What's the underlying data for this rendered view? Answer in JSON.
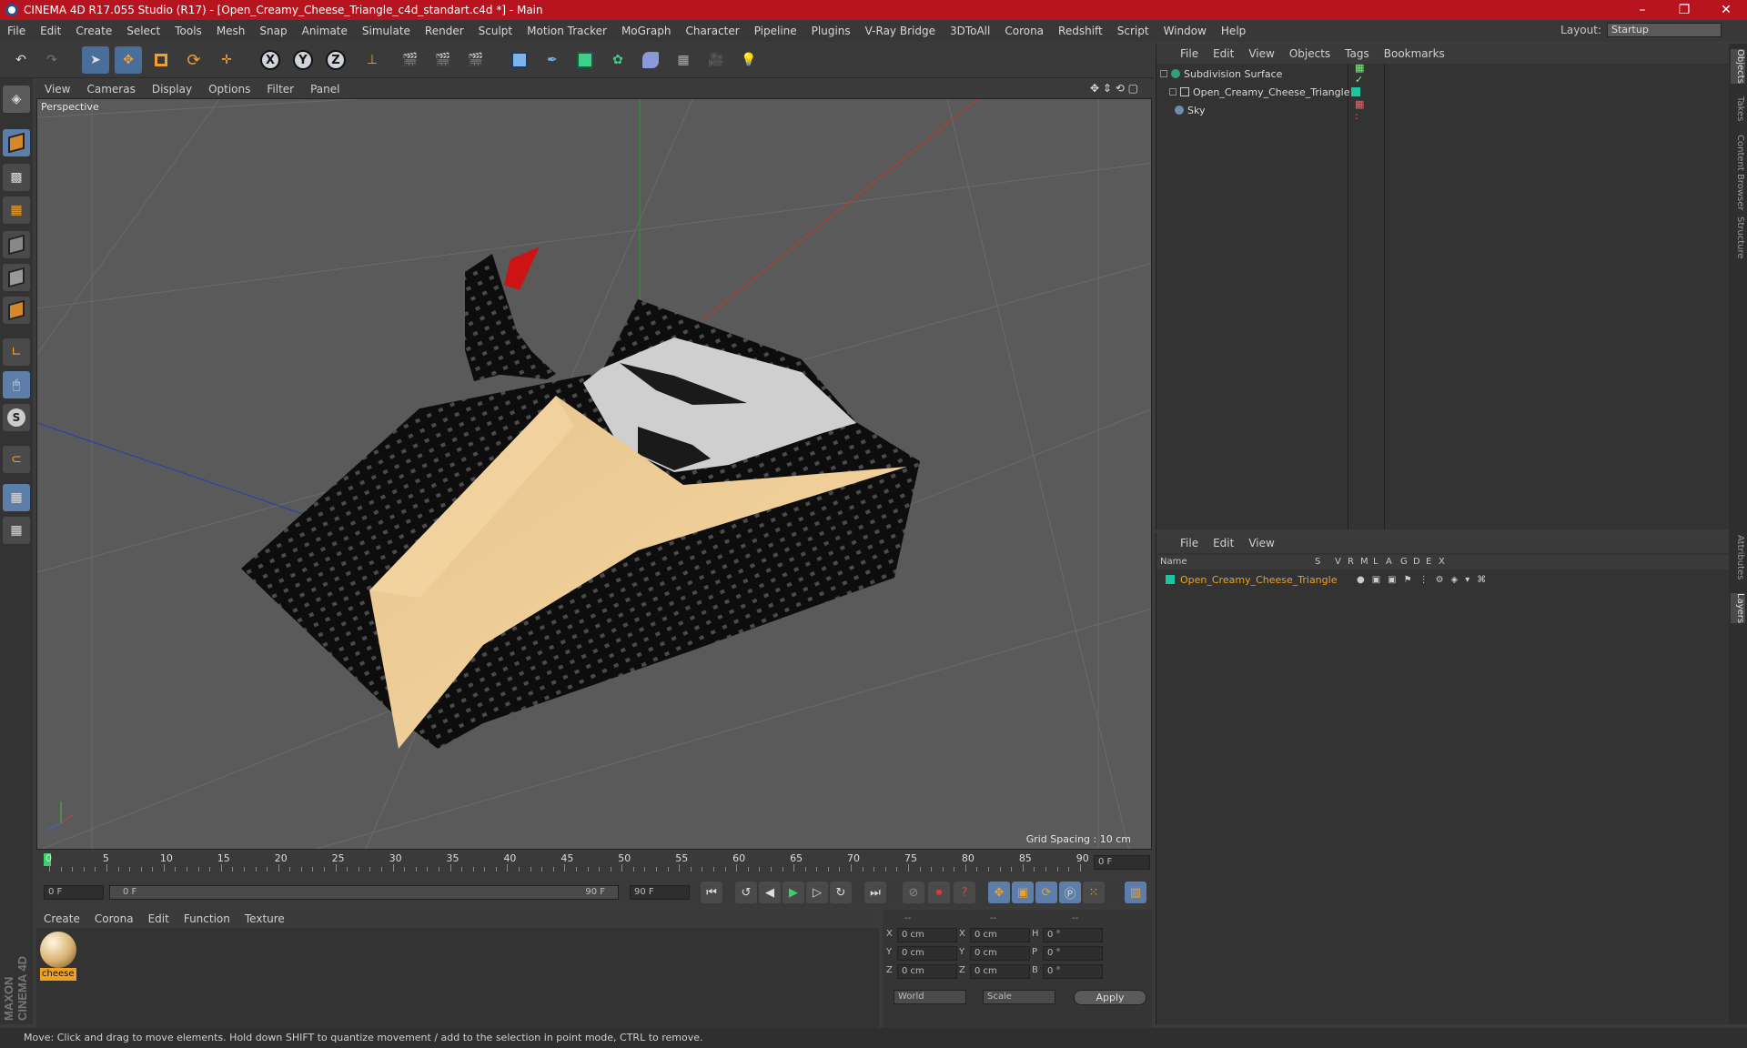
{
  "window": {
    "title": "CINEMA 4D R17.055 Studio (R17) - [Open_Creamy_Cheese_Triangle_c4d_standart.c4d *] - Main",
    "minimize": "–",
    "maximize": "❐",
    "close": "✕"
  },
  "menubar": [
    "File",
    "Edit",
    "Create",
    "Select",
    "Tools",
    "Mesh",
    "Snap",
    "Animate",
    "Simulate",
    "Render",
    "Sculpt",
    "Motion Tracker",
    "MoGraph",
    "Character",
    "Pipeline",
    "Plugins",
    "V-Ray Bridge",
    "3DToAll",
    "Corona",
    "Redshift",
    "Script",
    "Window",
    "Help"
  ],
  "layout": {
    "label": "Layout:",
    "value": "Startup"
  },
  "toolbar": {
    "axes": [
      "X",
      "Y",
      "Z"
    ]
  },
  "viewport": {
    "menu": [
      "View",
      "Cameras",
      "Display",
      "Options",
      "Filter",
      "Panel"
    ],
    "label": "Perspective",
    "grid_spacing": "Grid Spacing : 10 cm"
  },
  "timeline": {
    "ticks": [
      "0",
      "5",
      "10",
      "15",
      "20",
      "25",
      "30",
      "35",
      "40",
      "45",
      "50",
      "55",
      "60",
      "65",
      "70",
      "75",
      "80",
      "85",
      "90"
    ],
    "current_frame": "0 F",
    "start_field": "0 F",
    "range_start": "0 F",
    "range_end": "90 F",
    "end_field": "90 F"
  },
  "materials": {
    "menu": [
      "Create",
      "Corona",
      "Edit",
      "Function",
      "Texture"
    ],
    "items": [
      {
        "name": "cheese"
      }
    ]
  },
  "coordinates": {
    "header": [
      "--",
      "--",
      "--"
    ],
    "rows": [
      {
        "a": "X",
        "av": "0 cm",
        "b": "X",
        "bv": "0 cm",
        "c": "H",
        "cv": "0 °"
      },
      {
        "a": "Y",
        "av": "0 cm",
        "b": "Y",
        "bv": "0 cm",
        "c": "P",
        "cv": "0 °"
      },
      {
        "a": "Z",
        "av": "0 cm",
        "b": "Z",
        "bv": "0 cm",
        "c": "B",
        "cv": "0 °"
      }
    ],
    "mode": "World",
    "scale": "Scale",
    "apply": "Apply"
  },
  "object_manager": {
    "menu": [
      "File",
      "Edit",
      "View",
      "Objects",
      "Tags",
      "Bookmarks"
    ],
    "objects": [
      {
        "name": "Subdivision Surface",
        "color": "#2fa07a"
      },
      {
        "name": "Open_Creamy_Cheese_Triangle",
        "color": "#1ac6a0"
      },
      {
        "name": "Sky",
        "color": "#6e8cb0"
      }
    ]
  },
  "layer_manager": {
    "menu": [
      "File",
      "Edit",
      "View"
    ],
    "columns": [
      "Name",
      "S",
      "V",
      "R",
      "M",
      "L",
      "A",
      "G",
      "D",
      "E",
      "X"
    ],
    "layers": [
      {
        "name": "Open_Creamy_Cheese_Triangle",
        "color": "#1ac6a0"
      }
    ]
  },
  "side_tabs": [
    "Objects",
    "Takes",
    "Content Browser",
    "Structure",
    "Attributes",
    "Layers"
  ],
  "brand": "MAXON CINEMA 4D",
  "status": "Move: Click and drag to move elements. Hold down SHIFT to quantize movement / add to the selection in point mode, CTRL to remove."
}
